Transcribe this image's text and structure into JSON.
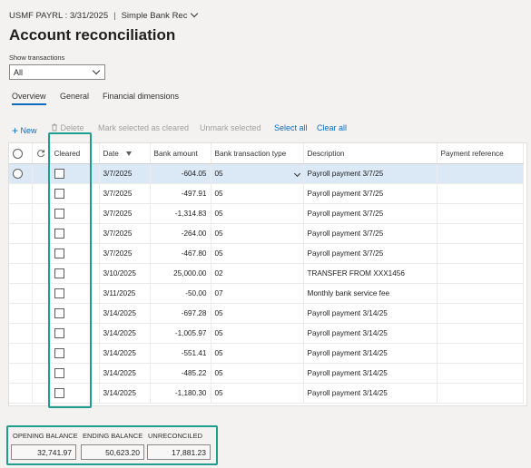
{
  "header": {
    "breadcrumb_company": "USMF PAYRL : 3/31/2025",
    "breadcrumb_separator": "|",
    "breadcrumb_view": "Simple Bank Rec",
    "title": "Account reconciliation"
  },
  "filter": {
    "label": "Show transactions",
    "value": "All"
  },
  "tabs": [
    "Overview",
    "General",
    "Financial dimensions"
  ],
  "toolbar": {
    "new": "New",
    "delete": "Delete",
    "mark_cleared": "Mark selected as cleared",
    "unmark_cleared": "Unmark selected",
    "select_all": "Select all",
    "clear_all": "Clear all"
  },
  "grid": {
    "columns": {
      "cleared": "Cleared",
      "date": "Date",
      "bank_amount": "Bank amount",
      "type": "Bank transaction type",
      "description": "Description",
      "payment_ref": "Payment reference"
    },
    "rows": [
      {
        "date": "3/7/2025",
        "amount": "-604.05",
        "type": "05",
        "desc": "Payroll payment 3/7/25",
        "ref": ""
      },
      {
        "date": "3/7/2025",
        "amount": "-497.91",
        "type": "05",
        "desc": "Payroll payment 3/7/25",
        "ref": ""
      },
      {
        "date": "3/7/2025",
        "amount": "-1,314.83",
        "type": "05",
        "desc": "Payroll payment 3/7/25",
        "ref": ""
      },
      {
        "date": "3/7/2025",
        "amount": "-264.00",
        "type": "05",
        "desc": "Payroll payment 3/7/25",
        "ref": ""
      },
      {
        "date": "3/7/2025",
        "amount": "-467.80",
        "type": "05",
        "desc": "Payroll payment 3/7/25",
        "ref": ""
      },
      {
        "date": "3/10/2025",
        "amount": "25,000.00",
        "type": "02",
        "desc": "TRANSFER FROM XXX1456",
        "ref": ""
      },
      {
        "date": "3/11/2025",
        "amount": "-50.00",
        "type": "07",
        "desc": "Monthly bank service fee",
        "ref": ""
      },
      {
        "date": "3/14/2025",
        "amount": "-697.28",
        "type": "05",
        "desc": "Payroll payment 3/14/25",
        "ref": ""
      },
      {
        "date": "3/14/2025",
        "amount": "-1,005.97",
        "type": "05",
        "desc": "Payroll payment 3/14/25",
        "ref": ""
      },
      {
        "date": "3/14/2025",
        "amount": "-551.41",
        "type": "05",
        "desc": "Payroll payment 3/14/25",
        "ref": ""
      },
      {
        "date": "3/14/2025",
        "amount": "-485.22",
        "type": "05",
        "desc": "Payroll payment 3/14/25",
        "ref": ""
      },
      {
        "date": "3/14/2025",
        "amount": "-1,180.30",
        "type": "05",
        "desc": "Payroll payment 3/14/25",
        "ref": ""
      }
    ]
  },
  "balances": {
    "opening_label": "OPENING BALANCE",
    "opening_value": "32,741.97",
    "ending_label": "ENDING BALANCE",
    "ending_value": "50,623.20",
    "unreconciled_label": "UNRECONCILED",
    "unreconciled_value": "17,881.23"
  },
  "colors": {
    "accent": "#0f6cbd",
    "highlight": "#1f9e8e",
    "selected_row": "#dbe8f6"
  }
}
